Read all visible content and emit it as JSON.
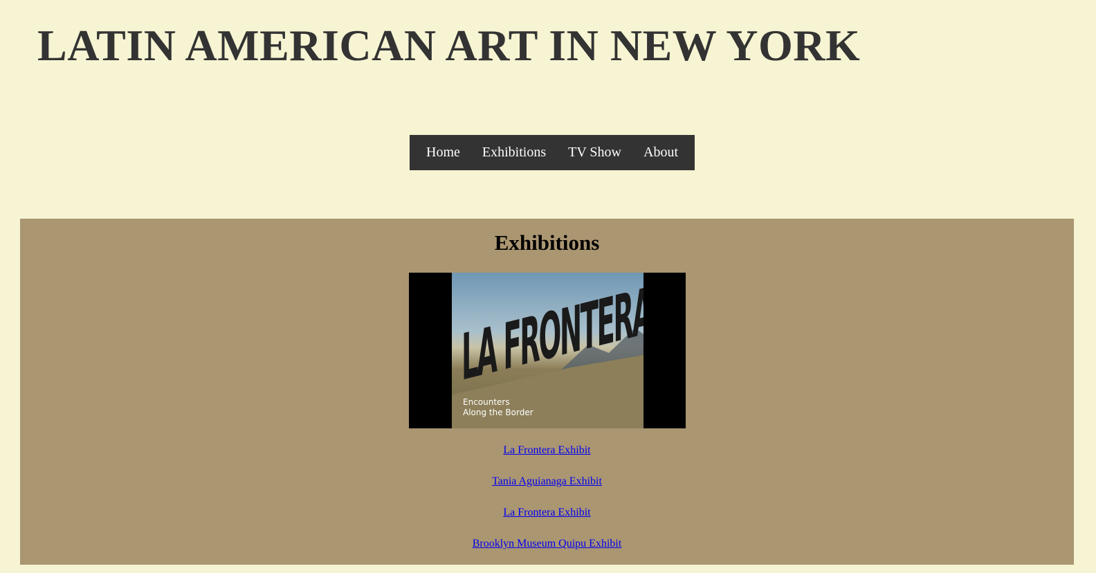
{
  "header": {
    "title": "LATIN AMERICAN ART IN NEW YORK"
  },
  "nav": {
    "items": [
      {
        "label": "Home"
      },
      {
        "label": "Exhibitions"
      },
      {
        "label": "TV Show"
      },
      {
        "label": "About"
      }
    ]
  },
  "exhibitions": {
    "heading": "Exhibitions",
    "poster": {
      "title": "LA FRONTERA",
      "subtitle_line1": "Encounters",
      "subtitle_line2": "Along the Border"
    },
    "links": [
      {
        "label": "La Frontera Exhibit"
      },
      {
        "label": "Tania Aguianaga Exhibit"
      },
      {
        "label": "La Frontera Exhibit"
      },
      {
        "label": "Brooklyn Museum Quipu Exhibit"
      }
    ]
  },
  "colors": {
    "page_background": "#f6f4d2",
    "title_text": "#333333",
    "nav_background": "#333333",
    "section_background": "#ab9672",
    "link": "#0000ee"
  }
}
